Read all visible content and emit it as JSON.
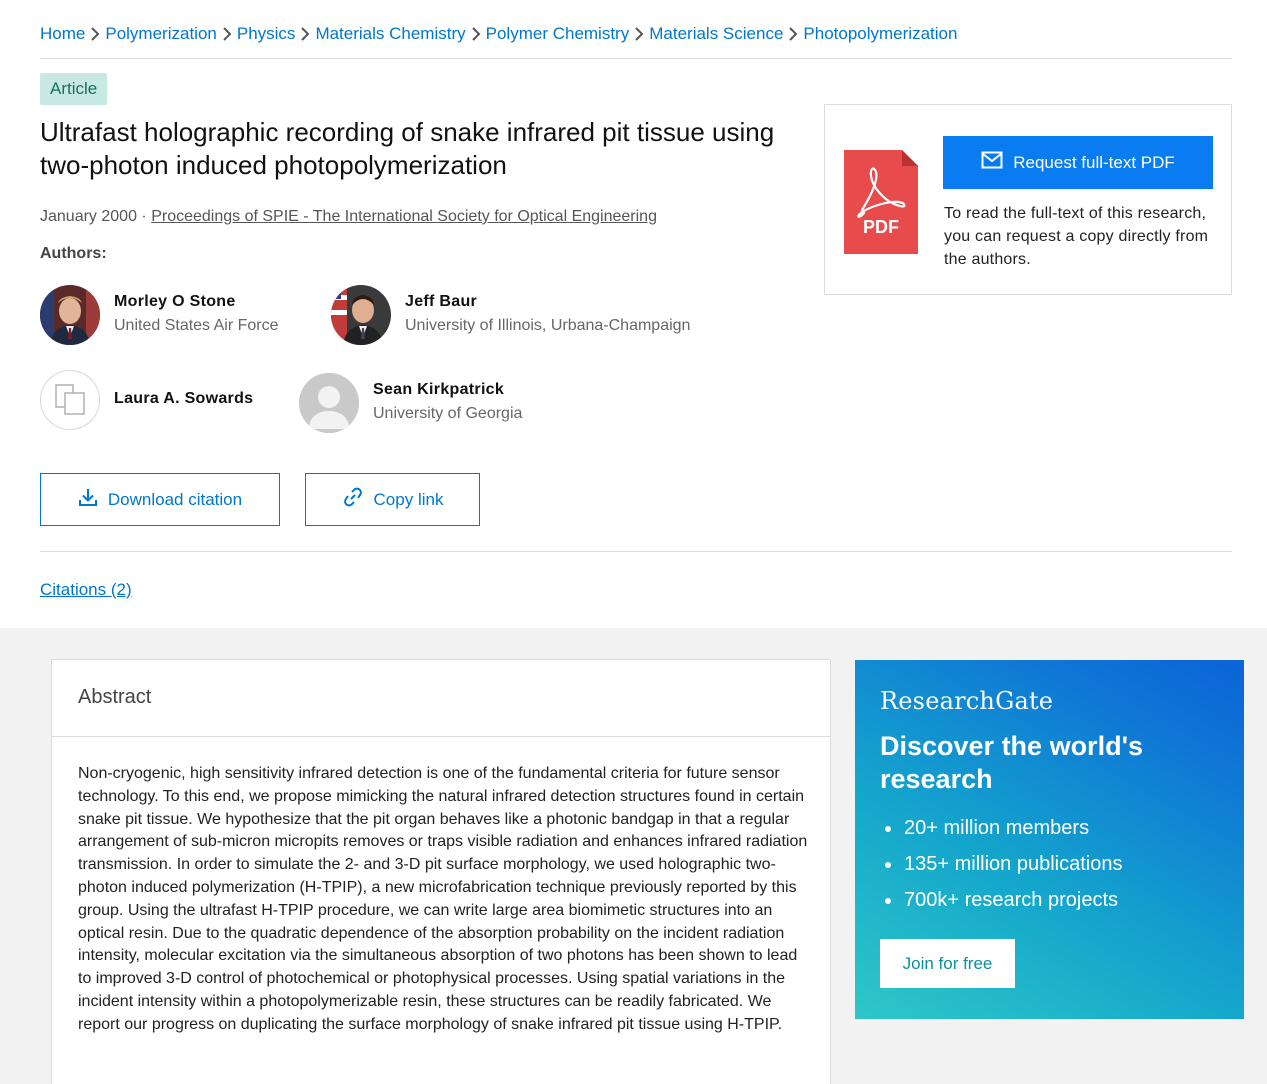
{
  "breadcrumb": [
    "Home",
    "Polymerization",
    "Physics",
    "Materials Chemistry",
    "Polymer Chemistry",
    "Materials Science",
    "Photopolymerization"
  ],
  "article": {
    "badge": "Article",
    "title": "Ultrafast holographic recording of snake infrared pit tissue using two-photon induced photopolymerization",
    "date": "January 2000",
    "separator": "·",
    "journal": "Proceedings of SPIE - The International Society for Optical Engineering",
    "authors_label": "Authors:"
  },
  "authors": [
    {
      "name": "Morley O Stone",
      "institution": "United States Air Force"
    },
    {
      "name": "Jeff Baur",
      "institution": "University of Illinois, Urbana-Champaign"
    },
    {
      "name": "Laura A. Sowards",
      "institution": ""
    },
    {
      "name": "Sean Kirkpatrick",
      "institution": "University of Georgia"
    }
  ],
  "actions": {
    "download_citation": "Download citation",
    "copy_link": "Copy link"
  },
  "citations": "Citations (2)",
  "pdf_panel": {
    "icon_text": "PDF",
    "request_button": "Request full-text PDF",
    "description": "To read the full-text of this research, you can request a copy directly from the authors."
  },
  "abstract": {
    "heading": "Abstract",
    "text": "Non-cryogenic, high sensitivity infrared detection is one of the fundamental criteria for future sensor technology. To this end, we propose mimicking the natural infrared detection structures found in certain snake pit tissue. We hypothesize that the pit organ behaves like a photonic bandgap in that a regular arrangement of sub-micron micropits removes or traps visible radiation and enhances infrared radiation transmission. In order to simulate the 2- and 3-D pit surface morphology, we used holographic two- photon induced polymerization (H-TPIP), a new microfabrication technique previously reported by this group. Using the ultrafast H-TPIP procedure, we can write large area biomimetic structures into an optical resin. Due to the quadratic dependence of the absorption probability on the incident radiation intensity, molecular excitation via the simultaneous absorption of two photons has been shown to lead to improved 3-D control of photochemical or photophysical processes. Using spatial variations in the incident intensity within a photopolymerizable resin, these structures can be readily fabricated. We report our progress on duplicating the surface morphology of snake infrared pit tissue using H-TPIP."
  },
  "promo": {
    "logo": "ResearchGate",
    "title": "Discover the world's research",
    "items": [
      "20+ million members",
      "135+ million publications",
      "700k+ research projects"
    ],
    "join_button": "Join for free"
  },
  "colors": {
    "link": "#0077cc",
    "primary_button": "#0a7cf2",
    "badge_bg": "#c8e8e4",
    "badge_text": "#19705f",
    "pdf_red": "#e84b4b"
  }
}
